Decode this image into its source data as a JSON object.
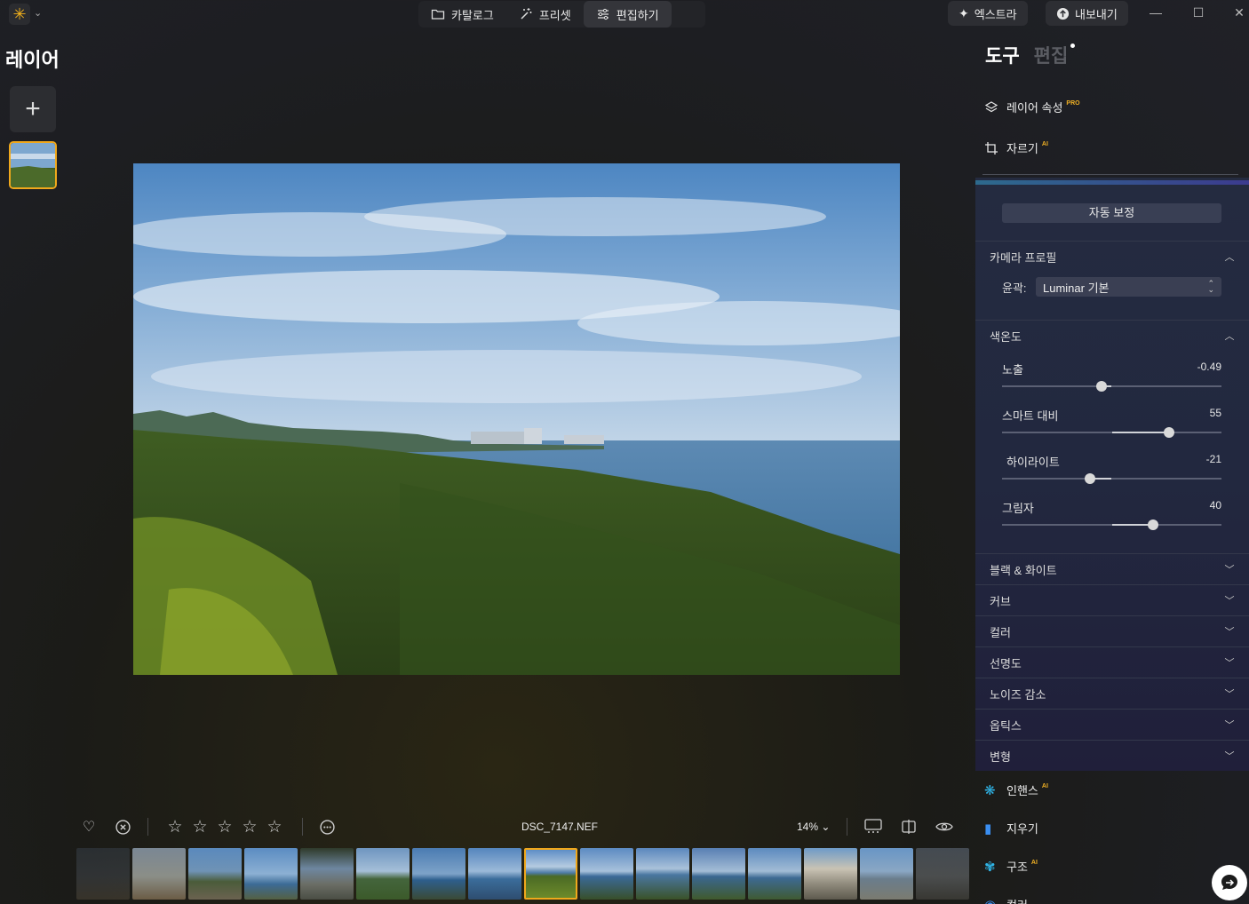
{
  "topbar": {
    "modes": [
      {
        "label": "카탈로그",
        "icon": "folder-icon"
      },
      {
        "label": "프리셋",
        "icon": "magic-wand-icon"
      },
      {
        "label": "편집하기",
        "icon": "sliders-icon",
        "active": true
      }
    ],
    "extras_label": "엑스트라",
    "export_label": "내보내기"
  },
  "layers": {
    "title": "레이어"
  },
  "bottom_bar": {
    "filename": "DSC_7147.NEF",
    "zoom": "14%",
    "rating": 0,
    "rating_max": 5
  },
  "filmstrip": {
    "count": 15,
    "selected_index": 7
  },
  "right_panel": {
    "tabs": {
      "tools": "도구",
      "edit": "편집"
    },
    "tools": [
      {
        "label": "레이어 속성",
        "tag": "PRO",
        "icon": "layers-icon"
      },
      {
        "label": "자르기",
        "tag": "AI",
        "icon": "crop-icon"
      }
    ],
    "auto_adjust": "자동 보정",
    "camera_profile": {
      "title": "카메라 프로필",
      "profile_label": "윤곽:",
      "profile_value": "Luminar 기본"
    },
    "tone": {
      "title": "색온도",
      "sliders": [
        {
          "label": "노출",
          "value": "-0.49",
          "pos": 0.455
        },
        {
          "label": "스마트 대비",
          "value": "55",
          "pos": 0.76
        },
        {
          "label": "하이라이트",
          "value": "-21",
          "pos": 0.4
        },
        {
          "label": "그림자",
          "value": "40",
          "pos": 0.69
        }
      ]
    },
    "collapsed_sections": [
      "블랙 & 화이트",
      "커브",
      "컬러",
      "선명도",
      "노이즈 감소",
      "옵틱스",
      "변형"
    ],
    "more_tools": [
      {
        "label": "인핸스",
        "tag": "AI",
        "icon": "sparkle-icon",
        "color": "#2fb5e8"
      },
      {
        "label": "지우기",
        "tag": "",
        "icon": "eraser-icon",
        "color": "#3a8ef0"
      },
      {
        "label": "구조",
        "tag": "AI",
        "icon": "structure-icon",
        "color": "#2fb5e8"
      },
      {
        "label": "컬러",
        "tag": "",
        "icon": "color-icon",
        "color": "#3a8ef0"
      }
    ]
  },
  "colors": {
    "accent": "#f0a81c",
    "panel_bg": "#22283f"
  }
}
